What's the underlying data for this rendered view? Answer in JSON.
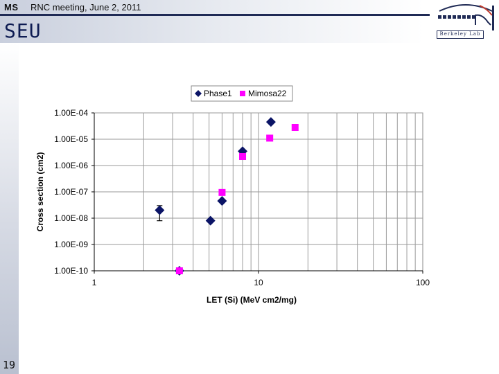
{
  "header": {
    "author": "MS",
    "meeting": "RNC meeting, June 2, 2011",
    "title": "SEU",
    "page_number": "19",
    "logo_text": "Berkeley Lab",
    "colors": {
      "header_line": "#1f2a55",
      "title": "#0d1b52"
    }
  },
  "chart_data": {
    "type": "scatter",
    "title": "",
    "xlabel": "LET (Si) (MeV cm2/mg)",
    "ylabel": "Cross section (cm2)",
    "xscale": "log",
    "yscale": "log",
    "xlim": [
      1,
      100
    ],
    "ylim": [
      1e-10,
      0.0001
    ],
    "x_ticks": [
      "1",
      "10",
      "100"
    ],
    "y_ticks": [
      "1.00E-10",
      "1.00E-09",
      "1.00E-08",
      "1.00E-07",
      "1.00E-06",
      "1.00E-05",
      "1.00E-04"
    ],
    "grid": true,
    "legend_position": "top",
    "series": [
      {
        "name": "Phase1",
        "marker": "diamond",
        "color": "#0b1466",
        "points": [
          {
            "x": 2.5,
            "y": 2e-08,
            "err_low": 8e-09,
            "err_high": 3e-08
          },
          {
            "x": 3.3,
            "y": 1e-10
          },
          {
            "x": 5.1,
            "y": 8e-09
          },
          {
            "x": 6.0,
            "y": 4.5e-08
          },
          {
            "x": 8.0,
            "y": 3.5e-06
          },
          {
            "x": 11.9,
            "y": 4.5e-05
          }
        ]
      },
      {
        "name": "Mimosa22",
        "marker": "square",
        "color": "#ff00ff",
        "points": [
          {
            "x": 3.3,
            "y": 1e-10
          },
          {
            "x": 6.0,
            "y": 9.5e-08
          },
          {
            "x": 8.0,
            "y": 2.2e-06
          },
          {
            "x": 11.7,
            "y": 1.1e-05
          },
          {
            "x": 16.7,
            "y": 2.8e-05
          }
        ]
      }
    ]
  }
}
